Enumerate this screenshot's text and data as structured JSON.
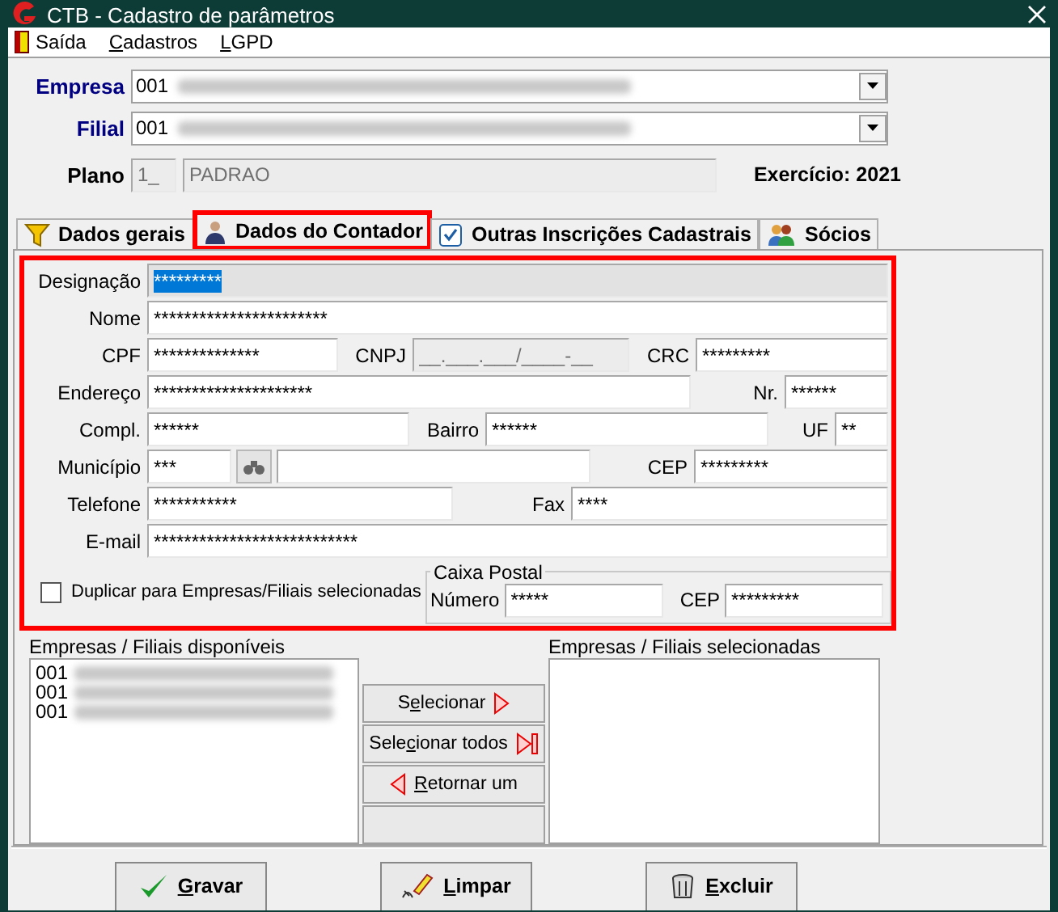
{
  "window": {
    "title": "CTB - Cadastro de parâmetros"
  },
  "menu": [
    {
      "before": "Saída"
    },
    {
      "key": "C",
      "after": "adastros"
    },
    {
      "key": "L",
      "after": "GPD"
    }
  ],
  "header": {
    "empresa": {
      "label": "Empresa",
      "code": "001"
    },
    "filial": {
      "label": "Filial",
      "code": "001"
    },
    "plano": {
      "label": "Plano",
      "code": "1_",
      "name": "PADRAO"
    },
    "exercicio": "Exercício: 2021"
  },
  "tabs": [
    {
      "label": "Dados gerais",
      "selected": false,
      "highlighted": false
    },
    {
      "label": "Dados do Contador",
      "selected": true,
      "highlighted": true
    },
    {
      "label": "Outras Inscrições Cadastrais",
      "selected": false,
      "highlighted": false
    },
    {
      "label": "Sócios",
      "selected": false,
      "highlighted": false
    }
  ],
  "form": {
    "highlighted": true,
    "designacao": {
      "label": "Designação",
      "value": "*********",
      "disabled": true,
      "selected": true
    },
    "nome": {
      "label": "Nome",
      "value": "***********************"
    },
    "cpf": {
      "label": "CPF",
      "value": "**************"
    },
    "cnpj": {
      "label": "CNPJ",
      "value": "__.___.___/____-__",
      "disabled": true
    },
    "crc": {
      "label": "CRC",
      "value": "*********"
    },
    "endereco": {
      "label": "Endereço",
      "value": "*********************"
    },
    "nr": {
      "label": "Nr.",
      "value": "******"
    },
    "compl": {
      "label": "Compl.",
      "value": "******"
    },
    "bairro": {
      "label": "Bairro",
      "value": "******"
    },
    "uf": {
      "label": "UF",
      "value": "**"
    },
    "municipio": {
      "label": "Município",
      "value": "***"
    },
    "cep": {
      "label": "CEP",
      "value": "*********"
    },
    "telefone": {
      "label": "Telefone",
      "value": "***********"
    },
    "fax": {
      "label": "Fax",
      "value": "****"
    },
    "email": {
      "label": "E-mail",
      "value": "***************************"
    },
    "duplicar": {
      "label": "Duplicar para Empresas/Filiais selecionadas",
      "checked": false
    },
    "caixa_postal": {
      "title": "Caixa Postal",
      "numero": {
        "label": "Número",
        "value": "*****"
      },
      "cep": {
        "label": "CEP",
        "value": "*********"
      }
    }
  },
  "available": {
    "label": "Empresas / Filiais disponíveis",
    "items": [
      {
        "code": "001"
      },
      {
        "code": "001"
      },
      {
        "code": "001"
      }
    ]
  },
  "transfer_buttons": [
    {
      "before": "S",
      "key": "e",
      "after": "lecionar"
    },
    {
      "before": "Sele",
      "key": "c",
      "after": "ionar todos"
    },
    {
      "key": "R",
      "after": "etornar um"
    }
  ],
  "selected_list": {
    "label": "Empresas / Filiais selecionadas"
  },
  "actions": [
    {
      "key": "G",
      "after": "ravar"
    },
    {
      "key": "L",
      "after": "impar"
    },
    {
      "key": "E",
      "after": "xcluir"
    }
  ]
}
